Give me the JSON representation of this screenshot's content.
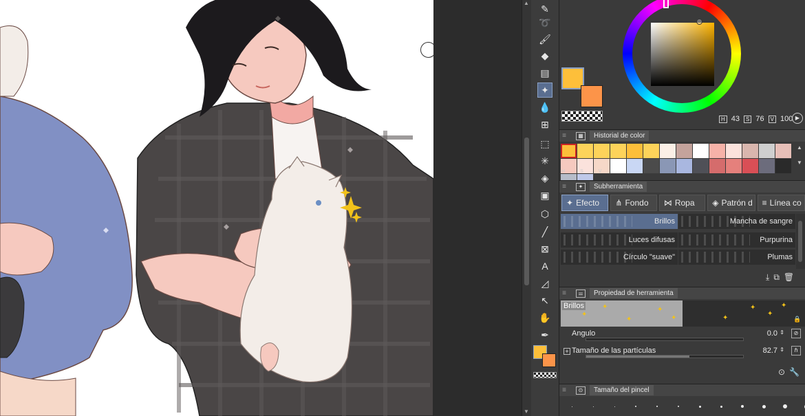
{
  "canvas": {
    "background": "#ffffff",
    "description_colors": {
      "hair": "#1c1a1d",
      "shirt": "#4a4646",
      "sweater": "#8190c4",
      "skin": "#f6c9bf",
      "cat": "#f3ede8",
      "sparkle": "#f2c21a"
    }
  },
  "toolbar": {
    "tools": [
      "pen-icon",
      "lasso-fill-icon",
      "brush-icon",
      "eraser-icon",
      "airbrush-icon",
      "sparkle-decoration-icon",
      "blend-icon",
      "mesh-transform-icon",
      "selection-icon",
      "auto-select-icon",
      "fill-icon",
      "gradient-icon",
      "3d-object-icon",
      "line-icon",
      "frame-icon",
      "text-icon",
      "ruler-icon",
      "object-select-icon",
      "hand-icon",
      "eyedropper-icon"
    ],
    "active_tool": "sparkle-decoration-icon",
    "main_color": "#fdbf3a",
    "sub_color": "#fc9449"
  },
  "color_wheel": {
    "main_color": "#fdbf3a",
    "sub_color": "#fc9449",
    "h": "43",
    "s": "76",
    "v": "100",
    "h_label": "H",
    "s_label": "S",
    "v_label": "V"
  },
  "history": {
    "title": "Historial de color",
    "colors": [
      "#fdbf3a",
      "#fdd35a",
      "#fdd35a",
      "#fdd35a",
      "#fdbf3a",
      "#fdd35a",
      "#fbefe6",
      "#c4a39c",
      "#ffffff",
      "#f6b2a8",
      "#fbe2dc",
      "#d9b6ae",
      "#cfcfcf",
      "#e7bfb8",
      "#f6c9bf",
      "#fbe2dc",
      "#f6d8c8",
      "#ffffff",
      "#c9d7f4",
      "#4b4b4b",
      "#8a97b5",
      "#a9b7e0",
      "#4f5057",
      "#d56c6c",
      "#e5807c",
      "#d94f56",
      "#6c6c7c",
      "#2a2a2a",
      "#b6bcc9",
      "#bfc9e9"
    ],
    "footer_icons": [
      "H",
      "S",
      "V"
    ]
  },
  "subtool": {
    "title": "Subherramienta",
    "tabs": [
      {
        "label": "Efecto",
        "icon": "sparkle-icon",
        "active": true
      },
      {
        "label": "Fondo",
        "icon": "grass-icon",
        "active": false
      },
      {
        "label": "Ropa",
        "icon": "bow-icon",
        "active": false
      },
      {
        "label": "Patrón d",
        "icon": "pattern-icon",
        "active": false
      },
      {
        "label": "Línea co",
        "icon": "lines-icon",
        "active": false
      }
    ],
    "brushes": [
      {
        "label": "Brillos",
        "active": true
      },
      {
        "label": "Mancha de sangre",
        "active": false
      },
      {
        "label": "Luces difusas",
        "active": false
      },
      {
        "label": "Purpurina",
        "active": false
      },
      {
        "label": "Círculo \"suave\"",
        "active": false
      },
      {
        "label": "Plumas",
        "active": false
      }
    ]
  },
  "tool_property": {
    "title": "Propiedad de herramienta",
    "preview_label": "Brillos",
    "rows": [
      {
        "name": "Angulo",
        "value": "0.0",
        "fill": 0
      },
      {
        "name": "Tamaño de las partículas",
        "value": "82.7",
        "fill": 0.66
      }
    ]
  },
  "brush_size": {
    "title": "Tamaño del pincel"
  }
}
